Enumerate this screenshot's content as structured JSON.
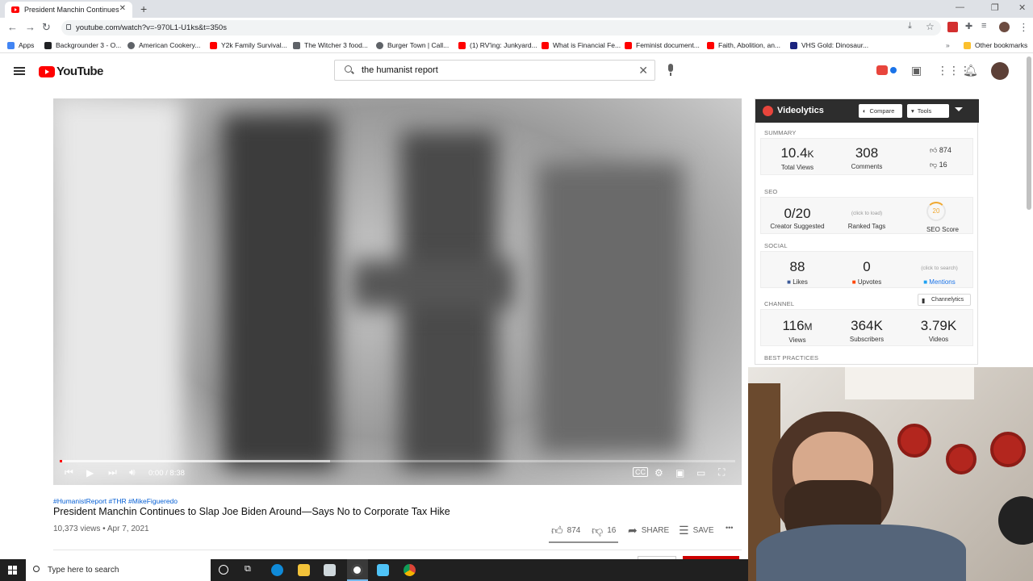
{
  "browser": {
    "tab_title": "President Manchin Continues to",
    "tab_close": "✕",
    "new_tab": "+",
    "url": "youtube.com/watch?v=-970L1-U1ks&t=350s",
    "bookmarks": [
      {
        "label": "Apps",
        "color": "#4285f4"
      },
      {
        "label": "Backgrounder 3 - O...",
        "color": "#202124"
      },
      {
        "label": "American Cookery...",
        "color": "#5f6368"
      },
      {
        "label": "Y2k Family Survival...",
        "color": "#ff0000"
      },
      {
        "label": "The Witcher 3 food...",
        "color": "#5f6368"
      },
      {
        "label": "Burger Town | Call...",
        "color": "#5f6368"
      },
      {
        "label": "(1) RV'ing: Junkyard...",
        "color": "#ff0000"
      },
      {
        "label": "What is Financial Fe...",
        "color": "#ff0000"
      },
      {
        "label": "Feminist document...",
        "color": "#ff0000"
      },
      {
        "label": "Faith, Abolition, an...",
        "color": "#ff0000"
      },
      {
        "label": "VHS Gold: Dinosaur...",
        "color": "#1a237e"
      }
    ],
    "other_bookmarks": "Other bookmarks"
  },
  "masthead": {
    "logo_text": "YouTube",
    "search_value": "the humanist report",
    "clear_glyph": "✕"
  },
  "player": {
    "time": "0:00 / 8:38",
    "played_fraction": 0.003,
    "loaded_fraction": 0.4
  },
  "video": {
    "hashtags": "#HumanistReport #THR #MikeFigueredo",
    "title": "President Manchin Continues to Slap Joe Biden Around—Says No to Corporate Tax Hike",
    "meta": "10,373 views • Apr 7, 2021",
    "likes": "874",
    "dislikes": "16",
    "share": "SHARE",
    "save": "SAVE",
    "more": "•••"
  },
  "videolytics": {
    "name": "Videolytics",
    "compare": "Compare",
    "tools": "Tools",
    "summary": {
      "label": "SUMMARY",
      "views_value": "10.4",
      "views_unit": "K",
      "views_label": "Total Views",
      "comments_value": "308",
      "comments_label": "Comments",
      "likes": "874",
      "dislikes": "16"
    },
    "seo": {
      "label": "SEO",
      "creator_value": "0/20",
      "creator_label": "Creator Suggested",
      "ranked_hint": "(click to load)",
      "ranked_label": "Ranked Tags",
      "score_value": "20",
      "score_label": "SEO Score"
    },
    "social": {
      "label": "SOCIAL",
      "likes_value": "88",
      "likes_label": "Likes",
      "upvotes_value": "0",
      "upvotes_label": "Upvotes",
      "mentions_hint": "(click to search)",
      "mentions_label": "Mentions"
    },
    "channel": {
      "label": "CHANNEL",
      "channelytics": "Channelytics",
      "views_value": "116",
      "views_unit": "M",
      "views_label": "Views",
      "subs_value": "364K",
      "subs_label": "Subscribers",
      "videos_value": "3.79K",
      "videos_label": "Videos"
    },
    "best_practices_label": "BEST PRACTICES"
  },
  "taskbar": {
    "search_placeholder": "Type here to search"
  }
}
